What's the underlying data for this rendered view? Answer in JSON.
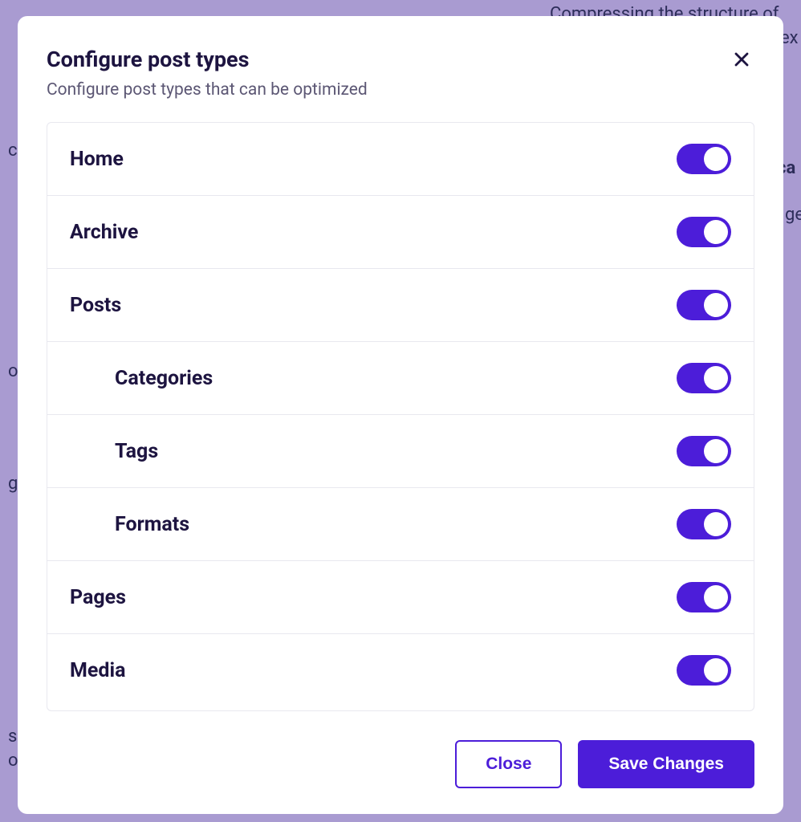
{
  "background": {
    "t1": "Compressing the structure of",
    "t2": "ex",
    "t3": "ch",
    "t4": "ca",
    "t5": "ge",
    "t6": "o",
    "t7": "g",
    "t8": " s",
    "t9": "or"
  },
  "modal": {
    "title": "Configure post types",
    "subtitle": "Configure post types that can be optimized",
    "rows": [
      {
        "label": "Home",
        "on": true,
        "nested": false
      },
      {
        "label": "Archive",
        "on": true,
        "nested": false
      },
      {
        "label": "Posts",
        "on": true,
        "nested": false
      },
      {
        "label": "Categories",
        "on": true,
        "nested": true
      },
      {
        "label": "Tags",
        "on": true,
        "nested": true
      },
      {
        "label": "Formats",
        "on": true,
        "nested": true
      },
      {
        "label": "Pages",
        "on": true,
        "nested": false
      },
      {
        "label": "Media",
        "on": true,
        "nested": false
      }
    ],
    "footer": {
      "close": "Close",
      "save": "Save Changes"
    }
  }
}
